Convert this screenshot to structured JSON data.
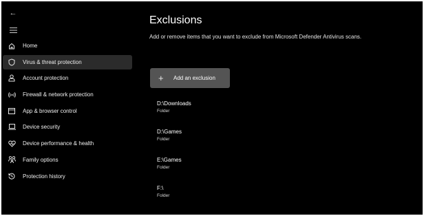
{
  "sidebar": {
    "back_icon": "←",
    "menu_icon": "hamburger-icon",
    "items": [
      {
        "label": "Home",
        "icon": "home-icon",
        "active": false
      },
      {
        "label": "Virus & threat protection",
        "icon": "shield-icon",
        "active": true
      },
      {
        "label": "Account protection",
        "icon": "person-icon",
        "active": false
      },
      {
        "label": "Firewall & network protection",
        "icon": "wireless-icon",
        "active": false
      },
      {
        "label": "App & browser control",
        "icon": "app-window-icon",
        "active": false
      },
      {
        "label": "Device security",
        "icon": "laptop-icon",
        "active": false
      },
      {
        "label": "Device performance & health",
        "icon": "heart-pulse-icon",
        "active": false
      },
      {
        "label": "Family options",
        "icon": "family-icon",
        "active": false
      },
      {
        "label": "Protection history",
        "icon": "history-icon",
        "active": false
      }
    ]
  },
  "main": {
    "title": "Exclusions",
    "subtitle": "Add or remove items that you want to exclude from Microsoft Defender Antivirus scans.",
    "add_button": {
      "icon": "+",
      "label": "Add an exclusion"
    },
    "exclusions": [
      {
        "path": "D:\\Downloads",
        "type": "Folder"
      },
      {
        "path": "D:\\Games",
        "type": "Folder"
      },
      {
        "path": "E:\\Games",
        "type": "Folder"
      },
      {
        "path": "F:\\",
        "type": "Folder"
      }
    ]
  },
  "colors": {
    "background": "#000000",
    "selected_nav": "#2b2b2b",
    "button": "#545454",
    "text": "#ffffff"
  }
}
